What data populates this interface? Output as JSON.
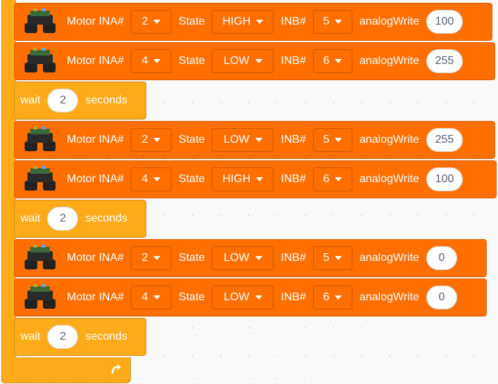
{
  "blocks": [
    {
      "kind": "motor",
      "ina_label": "Motor INA#",
      "ina": "2",
      "state_label": "State",
      "state": "HIGH",
      "inb_label": "INB#",
      "inb": "5",
      "aw_label": "analogWrite",
      "aw": "100"
    },
    {
      "kind": "motor",
      "ina_label": "Motor INA#",
      "ina": "4",
      "state_label": "State",
      "state": "LOW",
      "inb_label": "INB#",
      "inb": "6",
      "aw_label": "analogWrite",
      "aw": "255"
    },
    {
      "kind": "wait",
      "wait_label": "wait",
      "value": "2",
      "unit": "seconds"
    },
    {
      "kind": "motor",
      "ina_label": "Motor INA#",
      "ina": "2",
      "state_label": "State",
      "state": "LOW",
      "inb_label": "INB#",
      "inb": "5",
      "aw_label": "analogWrite",
      "aw": "255"
    },
    {
      "kind": "motor",
      "ina_label": "Motor INA#",
      "ina": "4",
      "state_label": "State",
      "state": "HIGH",
      "inb_label": "INB#",
      "inb": "6",
      "aw_label": "analogWrite",
      "aw": "100"
    },
    {
      "kind": "wait",
      "wait_label": "wait",
      "value": "2",
      "unit": "seconds"
    },
    {
      "kind": "motor",
      "ina_label": "Motor INA#",
      "ina": "2",
      "state_label": "State",
      "state": "LOW",
      "inb_label": "INB#",
      "inb": "5",
      "aw_label": "analogWrite",
      "aw": "0"
    },
    {
      "kind": "motor",
      "ina_label": "Motor INA#",
      "ina": "4",
      "state_label": "State",
      "state": "LOW",
      "inb_label": "INB#",
      "inb": "6",
      "aw_label": "analogWrite",
      "aw": "0"
    },
    {
      "kind": "wait",
      "wait_label": "wait",
      "value": "2",
      "unit": "seconds"
    }
  ],
  "icons": {
    "motor_block": "robot-car-icon",
    "dropdown": "caret-down-icon",
    "loop_end": "loop-arrow-icon"
  },
  "colors": {
    "motor_block": "#ff6f00",
    "control_block": "#ffab19",
    "input_text": "#575e75"
  }
}
